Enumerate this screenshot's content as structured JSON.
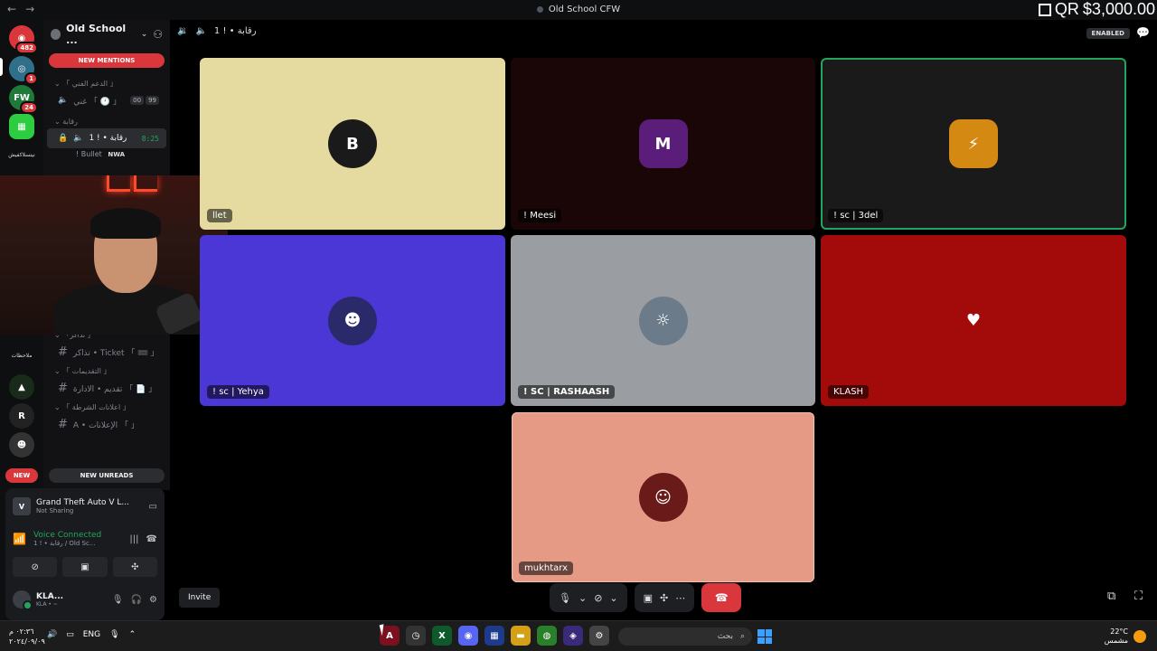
{
  "window": {
    "title": "Old School CFW",
    "back": "←",
    "forward": "→"
  },
  "overlay": {
    "qr_text": "QR",
    "amount": "$3,000.00"
  },
  "rail": {
    "dm_badge": "482",
    "servers": [
      {
        "name": "server-1",
        "badge": "1",
        "color": "#2f6f8a",
        "glyph": "◎"
      },
      {
        "name": "server-2",
        "badge": "24",
        "color": "#1f7a3a",
        "glyph": "FW"
      },
      {
        "name": "server-3",
        "badge": "",
        "color": "#2ecc40",
        "glyph": "▦"
      }
    ],
    "label_1": "نيتسلاكفيش",
    "label_2": "ملاحظات",
    "bottom_servers": [
      "R",
      "☻",
      "⛯"
    ]
  },
  "sidebar": {
    "guild_name": "Old School ...",
    "new_mentions": "NEW MENTIONS",
    "categories": {
      "support": "「 الدعم الفني 」 ⌄",
      "watch": "رقابة ⌄",
      "tickets": "「 تذاكر」 ⌄",
      "applications": "「 التقديمات 」 ⌄",
      "police": "「 اعلانات الشرطة 」 ⌄"
    },
    "channels": {
      "support_voice": "غني 「 🕐 」",
      "support_limit_a": "00",
      "support_limit_b": "99",
      "watch_voice": "رقابة • ! 1",
      "watch_time": "8:25",
      "ticket": "تذاكر • Ticket 「 🎟 」",
      "apply": "تقديم • الادارة 「 📄 」",
      "ads": "A • الإعلانات 「 」"
    },
    "member_name": "! Bullet",
    "member_tag": "NWA",
    "new_pill": "NEW",
    "new_unreads": "NEW UNREADS"
  },
  "panel": {
    "activity_title": "Grand Theft Auto V L...",
    "activity_sub": "Not Sharing",
    "voice_status": "Voice Connected",
    "voice_channel": "رقابة • ! 1 / Old Sc...",
    "username": "KLA...",
    "user_status": "KLA • ~"
  },
  "call": {
    "channel": "رقابة • ! 1",
    "enabled": "ENABLED",
    "invite": "Invite",
    "tiles": [
      {
        "name": "llet",
        "bg": "#e5dba0",
        "av_bg": "#1a1a1a",
        "glyph": "B"
      },
      {
        "name": "! Meesi",
        "bg": "#1a0606",
        "av_bg": "#5b1d7a",
        "glyph": "M"
      },
      {
        "name": "! sc | 3del",
        "bg": "#1a1a1a",
        "av_bg": "#d48a12",
        "glyph": "⚡"
      },
      {
        "name": "! sc | Yehya",
        "bg": "#4b36d6",
        "av_bg": "#2a2a6a",
        "glyph": "☻"
      },
      {
        "name": "! SC | RASHAASH",
        "bg": "#9a9ea3",
        "av_bg": "#6b7b8a",
        "glyph": "☼"
      },
      {
        "name": "KLASH",
        "bg": "#a30b0b",
        "av_bg": "#a30b0b",
        "glyph": "♥"
      },
      {
        "name": "mukhtarx",
        "bg": "#e59a86",
        "av_bg": "#6b1a1a",
        "glyph": "☺"
      }
    ]
  },
  "taskbar": {
    "time": "٠٢:٣٦ م",
    "date": "٢٠٢٤/٠٩/٠٩",
    "lang": "ENG",
    "search": "بحث",
    "temp": "22°C",
    "weather": "مشمس"
  }
}
